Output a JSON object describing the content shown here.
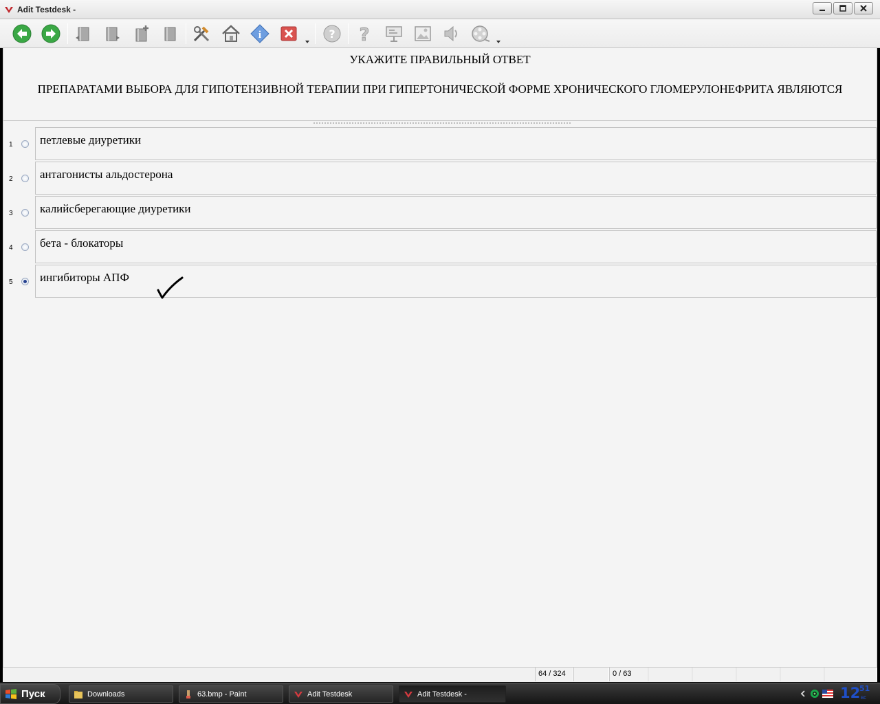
{
  "window": {
    "title": "Adit Testdesk -"
  },
  "toolbar": {
    "icons": [
      "back-arrow-icon",
      "forward-arrow-icon",
      "book-prev-icon",
      "book-next-icon",
      "book-add-icon",
      "book-icon",
      "tools-icon",
      "home-icon",
      "info-icon",
      "close-red-icon",
      "help-icon",
      "question-icon",
      "presentation-icon",
      "image-icon",
      "speaker-icon",
      "film-reel-icon"
    ]
  },
  "question": {
    "title": "УКАЖИТЕ ПРАВИЛЬНЫЙ ОТВЕТ",
    "text": "ПРЕПАРАТАМИ ВЫБОРА ДЛЯ ГИПОТЕНЗИВНОЙ ТЕРАПИИ ПРИ ГИПЕРТОНИЧЕСКОЙ ФОРМЕ ХРОНИЧЕСКОГО ГЛОМЕРУЛОНЕФРИТА ЯВЛЯЮТСЯ"
  },
  "answers": [
    {
      "num": "1",
      "text": "петлевые диуретики",
      "selected": false
    },
    {
      "num": "2",
      "text": "антагонисты альдостерона",
      "selected": false
    },
    {
      "num": "3",
      "text": "калийсберегающие диуретики",
      "selected": false
    },
    {
      "num": "4",
      "text": "бета - блокаторы",
      "selected": false
    },
    {
      "num": "5",
      "text": "ингибиторы АПФ",
      "selected": true
    }
  ],
  "status": {
    "progress": "64 / 324",
    "score": "0 / 63"
  },
  "taskbar": {
    "start": "Пуск",
    "tasks": [
      "Downloads",
      "63.bmp - Paint",
      "Adit Testdesk",
      "Adit Testdesk -"
    ],
    "clock_hour": "12",
    "clock_min": "51",
    "clock_day": "вс"
  },
  "colors": {
    "accent": "#25408f",
    "clock": "#1f4fc8",
    "close_red": "#d9534f",
    "nav_green": "#3aa845"
  }
}
